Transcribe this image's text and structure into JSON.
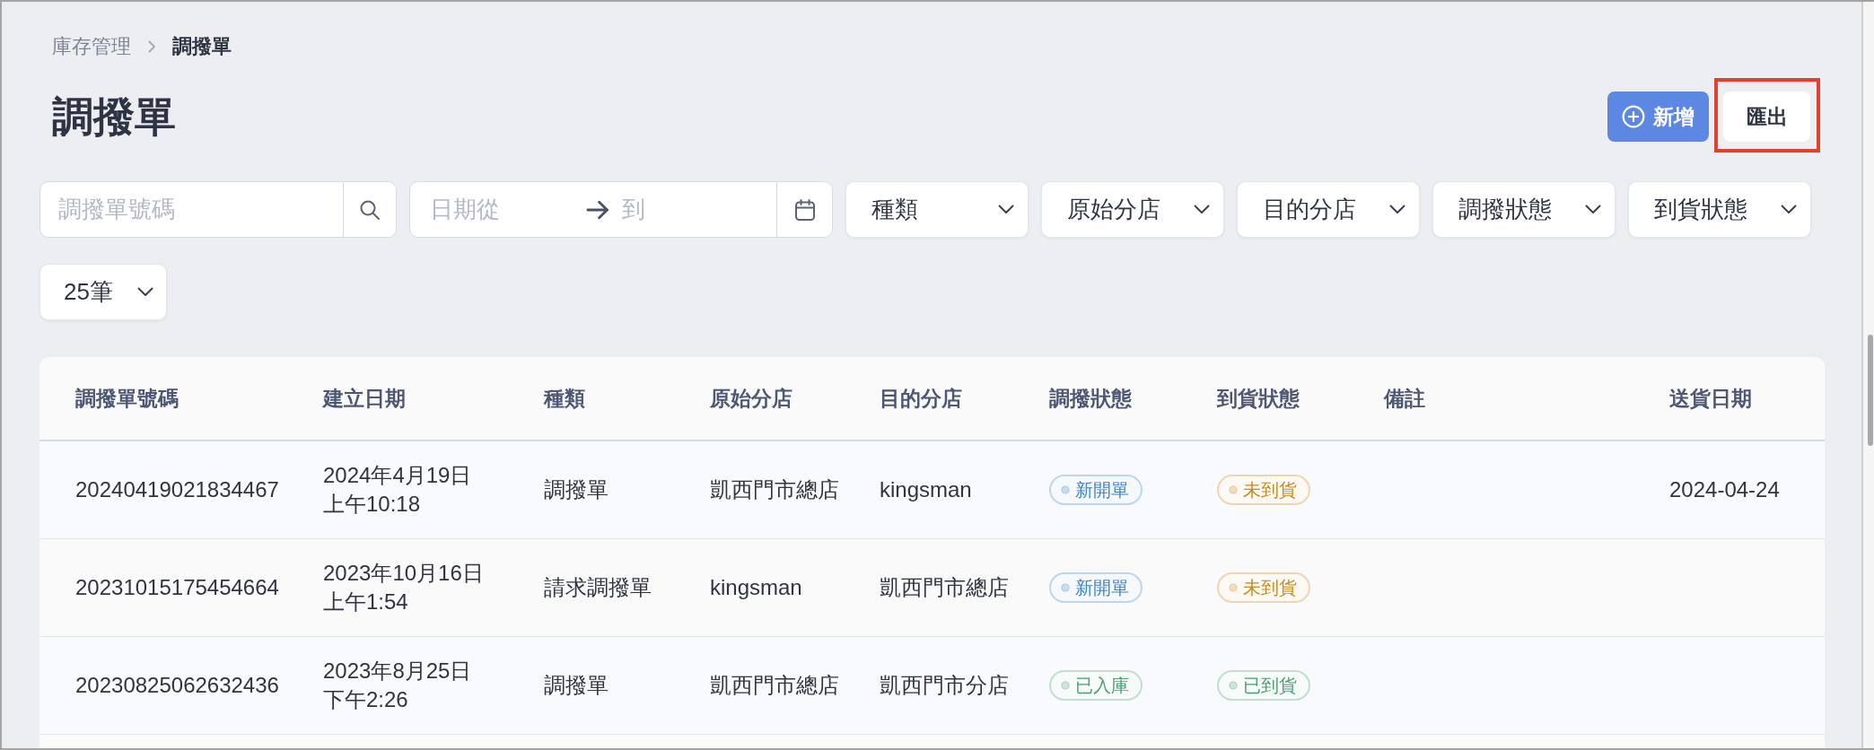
{
  "breadcrumb": [
    {
      "label": "庫存管理",
      "current": false
    },
    {
      "label": "調撥單",
      "current": true
    }
  ],
  "page_title": "調撥單",
  "actions": [
    {
      "label": "新增",
      "kind": "primary",
      "highlighted": false
    },
    {
      "label": "匯出",
      "kind": "secondary",
      "highlighted": true
    }
  ],
  "filters": {
    "search": {
      "placeholder": "調撥單號碼"
    },
    "date_range": {
      "from_placeholder": "日期從",
      "to_placeholder": "到"
    },
    "dropdowns": [
      {
        "label": "種類"
      },
      {
        "label": "原始分店"
      },
      {
        "label": "目的分店"
      },
      {
        "label": "調撥狀態"
      },
      {
        "label": "到貨狀態"
      }
    ],
    "page_size": {
      "value": "25筆"
    }
  },
  "table": {
    "columns": [
      "調撥單號碼",
      "建立日期",
      "種類",
      "原始分店",
      "目的分店",
      "調撥狀態",
      "到貨狀態",
      "備註",
      "送貨日期"
    ],
    "rows": [
      {
        "number": "20240419021834467",
        "created_date": "2024年4月19日",
        "created_time": "上午10:18",
        "type": "調撥單",
        "origin_store": "凱西門市總店",
        "destination_store": "kingsman",
        "transfer_status": {
          "label": "新開單",
          "color": "#3f84c4"
        },
        "arrival_status": {
          "label": "未到貨",
          "color": "#c68a1c"
        },
        "delivery_date": "2024-04-24"
      },
      {
        "number": "20231015175454664",
        "created_date": "2023年10月16日",
        "created_time": "上午1:54",
        "type": "請求調撥單",
        "origin_store": "kingsman",
        "destination_store": "凱西門市總店",
        "transfer_status": {
          "label": "新開單",
          "color": "#3f84c4"
        },
        "arrival_status": {
          "label": "未到貨",
          "color": "#c68a1c"
        }
      },
      {
        "number": "20230825062632436",
        "created_date": "2023年8月25日",
        "created_time": "下午2:26",
        "type": "調撥單",
        "origin_store": "凱西門市總店",
        "destination_store": "凱西門市分店",
        "transfer_status": {
          "label": "已入庫",
          "color": "#4f9b76"
        },
        "arrival_status": {
          "label": "已到貨",
          "color": "#4f9b76"
        }
      }
    ]
  }
}
